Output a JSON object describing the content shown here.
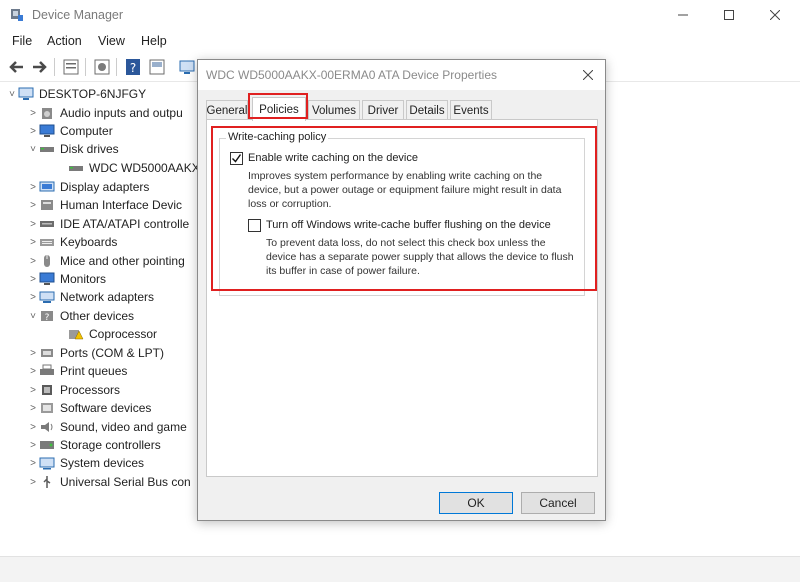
{
  "window": {
    "title": "Device Manager"
  },
  "menu": {
    "file": "File",
    "action": "Action",
    "view": "View",
    "help": "Help"
  },
  "tree": [
    {
      "label": "DESKTOP-6NJFGY",
      "chevron": "˅",
      "icon": "computer-icon"
    },
    {
      "label": "Audio inputs and outpu",
      "chevron": ">",
      "icon": "speaker-icon"
    },
    {
      "label": "Computer",
      "chevron": ">",
      "icon": "monitor-icon"
    },
    {
      "label": "Disk drives",
      "chevron": "˅",
      "icon": "disk-icon"
    },
    {
      "label": "WDC WD5000AAKX-",
      "chevron": "",
      "icon": "disk-icon"
    },
    {
      "label": "Display adapters",
      "chevron": ">",
      "icon": "display-adapter-icon"
    },
    {
      "label": "Human Interface Devic",
      "chevron": ">",
      "icon": "hid-icon"
    },
    {
      "label": "IDE ATA/ATAPI controlle",
      "chevron": ">",
      "icon": "ide-icon"
    },
    {
      "label": "Keyboards",
      "chevron": ">",
      "icon": "keyboard-icon"
    },
    {
      "label": "Mice and other pointing",
      "chevron": ">",
      "icon": "mouse-icon"
    },
    {
      "label": "Monitors",
      "chevron": ">",
      "icon": "monitor-icon"
    },
    {
      "label": "Network adapters",
      "chevron": ">",
      "icon": "network-icon"
    },
    {
      "label": "Other devices",
      "chevron": "˅",
      "icon": "other-devices-icon"
    },
    {
      "label": "Coprocessor",
      "chevron": "",
      "icon": "warning-device-icon"
    },
    {
      "label": "Ports (COM & LPT)",
      "chevron": ">",
      "icon": "port-icon"
    },
    {
      "label": "Print queues",
      "chevron": ">",
      "icon": "printer-icon"
    },
    {
      "label": "Processors",
      "chevron": ">",
      "icon": "processor-icon"
    },
    {
      "label": "Software devices",
      "chevron": ">",
      "icon": "software-icon"
    },
    {
      "label": "Sound, video and game",
      "chevron": ">",
      "icon": "sound-icon"
    },
    {
      "label": "Storage controllers",
      "chevron": ">",
      "icon": "storage-icon"
    },
    {
      "label": "System devices",
      "chevron": ">",
      "icon": "system-icon"
    },
    {
      "label": "Universal Serial Bus con",
      "chevron": ">",
      "icon": "usb-icon"
    }
  ],
  "dialog": {
    "title": "WDC WD5000AAKX-00ERMA0 ATA Device Properties",
    "tabs": {
      "general": "General",
      "policies": "Policies",
      "volumes": "Volumes",
      "driver": "Driver",
      "details": "Details",
      "events": "Events"
    },
    "group_label": "Write-caching policy",
    "enable_cache": {
      "label": "Enable write caching on the device",
      "checked": true,
      "description": "Improves system performance by enabling write caching on the device, but a power outage or equipment failure might result in data loss or corruption."
    },
    "turn_off_flush": {
      "label": "Turn off Windows write-cache buffer flushing on the device",
      "checked": false,
      "description": "To prevent data loss, do not select this check box unless the device has a separate power supply that allows the device to flush its buffer in case of power failure."
    },
    "ok_label": "OK",
    "cancel_label": "Cancel"
  },
  "colors": {
    "highlight": "#e02020",
    "accent": "#0078d7"
  }
}
